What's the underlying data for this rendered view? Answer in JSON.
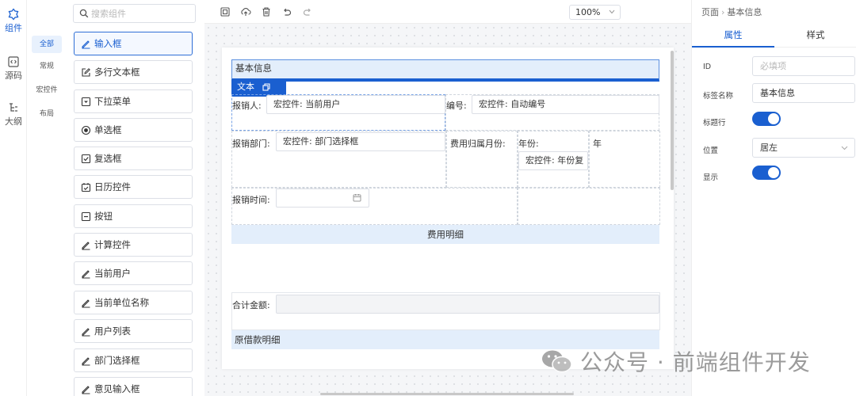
{
  "rail": [
    {
      "label": "组件",
      "icon": "components-icon",
      "active": true
    },
    {
      "label": "源码",
      "icon": "code-icon",
      "active": false
    },
    {
      "label": "大纲",
      "icon": "outline-icon",
      "active": false
    }
  ],
  "categories": [
    {
      "label": "全部",
      "active": true
    },
    {
      "label": "常规",
      "active": false
    },
    {
      "label": "宏控件",
      "active": false
    },
    {
      "label": "布局",
      "active": false
    }
  ],
  "search": {
    "placeholder": "搜索组件",
    "value": ""
  },
  "components": [
    {
      "label": "输入框",
      "icon": "pencil-icon",
      "active": true
    },
    {
      "label": "多行文本框",
      "icon": "edit-box-icon",
      "active": false
    },
    {
      "label": "下拉菜单",
      "icon": "dropdown-icon",
      "active": false
    },
    {
      "label": "单选框",
      "icon": "radio-icon",
      "active": false
    },
    {
      "label": "复选框",
      "icon": "checkbox-icon",
      "active": false
    },
    {
      "label": "日历控件",
      "icon": "calendar-check-icon",
      "active": false
    },
    {
      "label": "按钮",
      "icon": "button-icon",
      "active": false
    },
    {
      "label": "计算控件",
      "icon": "pencil-icon",
      "active": false
    },
    {
      "label": "当前用户",
      "icon": "pencil-icon",
      "active": false
    },
    {
      "label": "当前单位名称",
      "icon": "pencil-icon",
      "active": false
    },
    {
      "label": "用户列表",
      "icon": "pencil-icon",
      "active": false
    },
    {
      "label": "部门选择框",
      "icon": "pencil-icon",
      "active": false
    },
    {
      "label": "意见输入框",
      "icon": "pencil-icon",
      "active": false
    }
  ],
  "toolbar": {
    "buttons": [
      "preview-icon",
      "upload-icon",
      "trash-icon",
      "undo-icon",
      "redo-icon"
    ],
    "zoom": "100%"
  },
  "form": {
    "section_title": "基本信息",
    "selected_tag": {
      "label": "文本",
      "icons": [
        "copy-icon",
        "trash-icon"
      ]
    },
    "reporter_label": "报销人:",
    "reporter_value": "宏控件: 当前用户",
    "number_label": "编号:",
    "number_value": "宏控件: 自动编号",
    "dept_label": "报销部门:",
    "dept_value": "宏控件: 部门选择框",
    "month_label": "费用归属月份:",
    "year_label": "年份:",
    "year_value": "宏控件: 年份复",
    "year_unit": "年",
    "time_label": "报销时间:",
    "detail_band": "费用明细",
    "total_label": "合计金额:",
    "loan_band": "原借款明细"
  },
  "right_panel": {
    "breadcrumb": [
      "页面",
      "基本信息"
    ],
    "tabs": [
      {
        "label": "属性",
        "active": true
      },
      {
        "label": "样式",
        "active": false
      }
    ],
    "props": {
      "id_label": "ID",
      "id_placeholder": "必填项",
      "tag_name_label": "标签名称",
      "tag_name_value": "基本信息",
      "title_row_label": "标题行",
      "title_row_on": true,
      "position_label": "位置",
      "position_value": "居左",
      "display_label": "显示",
      "display_on": true
    }
  },
  "watermark": "公众号 · 前端组件开发",
  "colors": {
    "accent": "#1a5fd0",
    "section_bg": "#e3eefb"
  }
}
